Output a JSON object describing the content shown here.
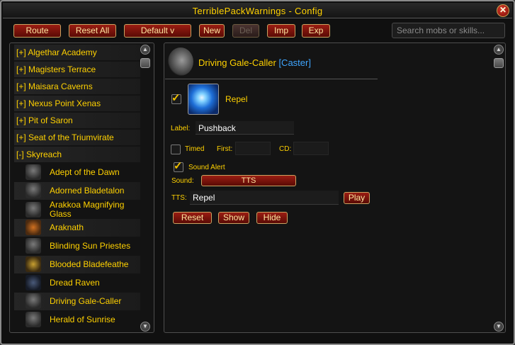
{
  "window": {
    "title": "TerriblePackWarnings - Config",
    "close_glyph": "✕"
  },
  "toolbar": {
    "route": "Route",
    "reset_all": "Reset All",
    "default": "Default v",
    "new": "New",
    "del": "Del",
    "imp": "Imp",
    "exp": "Exp",
    "search_placeholder": "Search mobs or skills..."
  },
  "dungeons": [
    {
      "label": "[+] Algethar Academy"
    },
    {
      "label": "[+] Magisters Terrace"
    },
    {
      "label": "[+] Maisara Caverns"
    },
    {
      "label": "[+] Nexus Point Xenas"
    },
    {
      "label": "[+] Pit of Saron"
    },
    {
      "label": "[+] Seat of the Triumvirate"
    },
    {
      "label": "[-] Skyreach"
    }
  ],
  "mobs": [
    {
      "label": "Adept of the Dawn",
      "icon": "mob-portrait-icon"
    },
    {
      "label": "Adorned Bladetalon",
      "icon": "mob-portrait-icon"
    },
    {
      "label": "Arakkoa Magnifying Glass",
      "icon": "mob-portrait-icon"
    },
    {
      "label": "Araknath",
      "icon": "mob-portrait-icon"
    },
    {
      "label": "Blinding Sun Priestes",
      "icon": "mob-portrait-icon"
    },
    {
      "label": "Blooded Bladefeathe",
      "icon": "mob-portrait-icon"
    },
    {
      "label": "Dread Raven",
      "icon": "mob-portrait-icon"
    },
    {
      "label": "Driving Gale-Caller",
      "icon": "mob-portrait-icon"
    },
    {
      "label": "Herald of Sunrise",
      "icon": "mob-portrait-icon"
    }
  ],
  "detail": {
    "mob_name": "Driving Gale-Caller",
    "mob_tag": "[Caster]",
    "spell": {
      "name": "Repel",
      "enabled": true,
      "icon": "frost-wind-spell-icon"
    },
    "label_caption": "Label:",
    "label_value": "Pushback",
    "timed_caption": "Timed",
    "timed_checked": false,
    "first_caption": "First:",
    "cd_caption": "CD:",
    "sound_alert_caption": "Sound Alert",
    "sound_alert_checked": true,
    "sound_caption": "Sound:",
    "sound_value": "TTS",
    "tts_caption": "TTS:",
    "tts_value": "Repel",
    "play": "Play",
    "reset": "Reset",
    "show": "Show",
    "hide": "Hide"
  },
  "colors": {
    "gold_text": "#ffd100",
    "caster_tag": "#3fa6ff",
    "button_red": "#9b1d12",
    "button_border": "#c9a462"
  }
}
